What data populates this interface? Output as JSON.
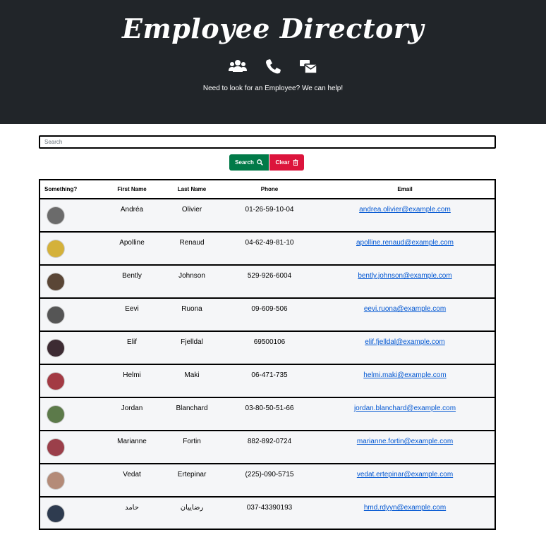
{
  "header": {
    "title": "Employee Directory",
    "subtitle": "Need to look for an Employee? We can help!",
    "icons": [
      "users-icon",
      "phone-icon",
      "mail-bulk-icon"
    ]
  },
  "search": {
    "placeholder": "Search",
    "value": "",
    "search_label": "Search",
    "clear_label": "Clear"
  },
  "table": {
    "columns": [
      "Something?",
      "First Name",
      "Last Name",
      "Phone",
      "Email"
    ],
    "rows": [
      {
        "first": "Andréa",
        "last": "Olivier",
        "phone": "01-26-59-10-04",
        "email": "andrea.olivier@example.com",
        "avatar_color": "#6b6b6b"
      },
      {
        "first": "Apolline",
        "last": "Renaud",
        "phone": "04-62-49-81-10",
        "email": "apolline.renaud@example.com",
        "avatar_color": "#d4b13a"
      },
      {
        "first": "Bently",
        "last": "Johnson",
        "phone": "529-926-6004",
        "email": "bently.johnson@example.com",
        "avatar_color": "#5a4636"
      },
      {
        "first": "Eevi",
        "last": "Ruona",
        "phone": "09-609-506",
        "email": "eevi.ruona@example.com",
        "avatar_color": "#555555"
      },
      {
        "first": "Elif",
        "last": "Fjelldal",
        "phone": "69500106",
        "email": "elif.fjelldal@example.com",
        "avatar_color": "#3d2b33"
      },
      {
        "first": "Helmi",
        "last": "Maki",
        "phone": "06-471-735",
        "email": "helmi.maki@example.com",
        "avatar_color": "#a33a44"
      },
      {
        "first": "Jordan",
        "last": "Blanchard",
        "phone": "03-80-50-51-66",
        "email": "jordan.blanchard@example.com",
        "avatar_color": "#5c7a4a"
      },
      {
        "first": "Marianne",
        "last": "Fortin",
        "phone": "882-892-0724",
        "email": "marianne.fortin@example.com",
        "avatar_color": "#9b3f4a"
      },
      {
        "first": "Vedat",
        "last": "Ertepinar",
        "phone": "(225)-090-5715",
        "email": "vedat.ertepinar@example.com",
        "avatar_color": "#b48b78"
      },
      {
        "first": "حامد",
        "last": "رضاییان",
        "phone": "037-43390193",
        "email": "hmd.rdyyn@example.com",
        "avatar_color": "#2e3b4f"
      }
    ]
  },
  "colors": {
    "header_bg": "#212529",
    "search_button": "#017a48",
    "clear_button": "#dc143c",
    "link": "#0056d2"
  }
}
